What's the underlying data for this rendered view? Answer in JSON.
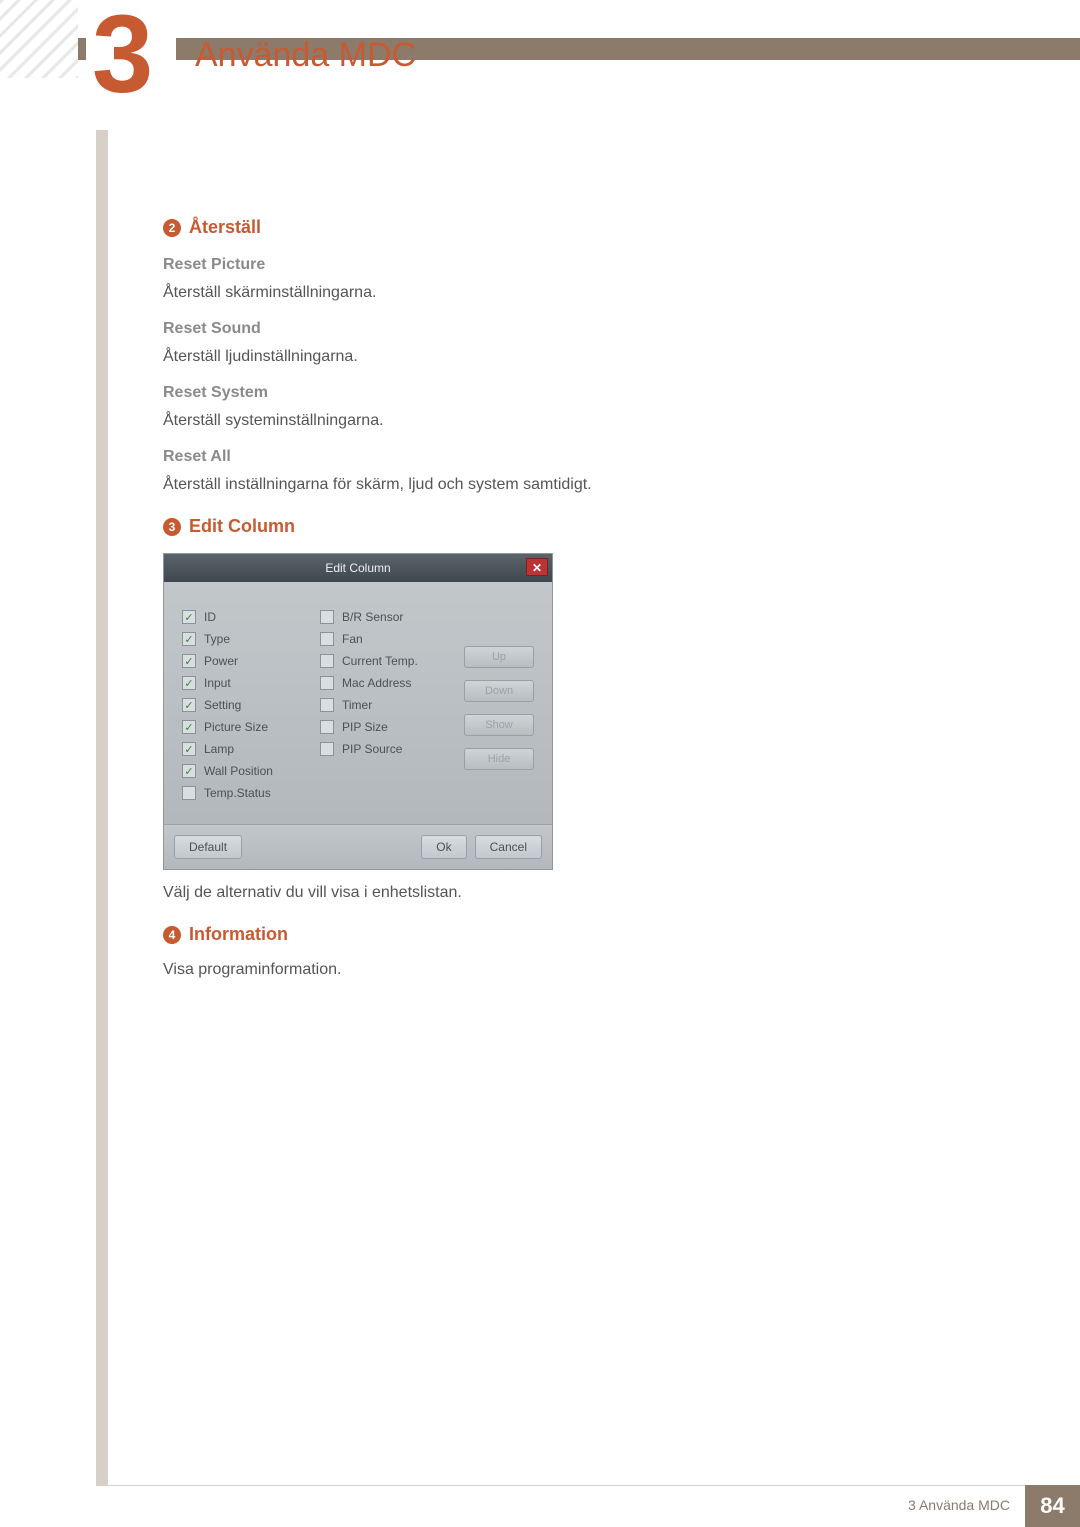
{
  "chapter": {
    "number": "3",
    "title": "Använda MDC"
  },
  "sections": {
    "s2": {
      "num": "2",
      "title": "Återställ",
      "items": [
        {
          "head": "Reset Picture",
          "body": "Återställ skärminställningarna."
        },
        {
          "head": "Reset Sound",
          "body": "Återställ ljudinställningarna."
        },
        {
          "head": "Reset System",
          "body": "Återställ systeminställningarna."
        },
        {
          "head": "Reset All",
          "body": "Återställ inställningarna för skärm, ljud och system samtidigt."
        }
      ]
    },
    "s3": {
      "num": "3",
      "title": "Edit Column",
      "caption": "Välj de alternativ du vill visa i enhetslistan."
    },
    "s4": {
      "num": "4",
      "title": "Information",
      "body": "Visa programinformation."
    }
  },
  "dialog": {
    "title": "Edit Column",
    "close": "✕",
    "left": [
      {
        "label": "ID",
        "checked": true
      },
      {
        "label": "Type",
        "checked": true
      },
      {
        "label": "Power",
        "checked": true
      },
      {
        "label": "Input",
        "checked": true
      },
      {
        "label": "Setting",
        "checked": true
      },
      {
        "label": "Picture Size",
        "checked": true
      },
      {
        "label": "Lamp",
        "checked": true
      },
      {
        "label": "Wall Position",
        "checked": true
      },
      {
        "label": "Temp.Status",
        "checked": false
      }
    ],
    "right": [
      {
        "label": "B/R Sensor",
        "checked": false
      },
      {
        "label": "Fan",
        "checked": false
      },
      {
        "label": "Current Temp.",
        "checked": false
      },
      {
        "label": "Mac Address",
        "checked": false
      },
      {
        "label": "Timer",
        "checked": false
      },
      {
        "label": "PIP Size",
        "checked": false
      },
      {
        "label": "PIP Source",
        "checked": false
      }
    ],
    "side": {
      "up": "Up",
      "down": "Down",
      "show": "Show",
      "hide": "Hide"
    },
    "footer": {
      "default": "Default",
      "ok": "Ok",
      "cancel": "Cancel"
    }
  },
  "footer": {
    "text": "3 Använda MDC",
    "page": "84"
  }
}
